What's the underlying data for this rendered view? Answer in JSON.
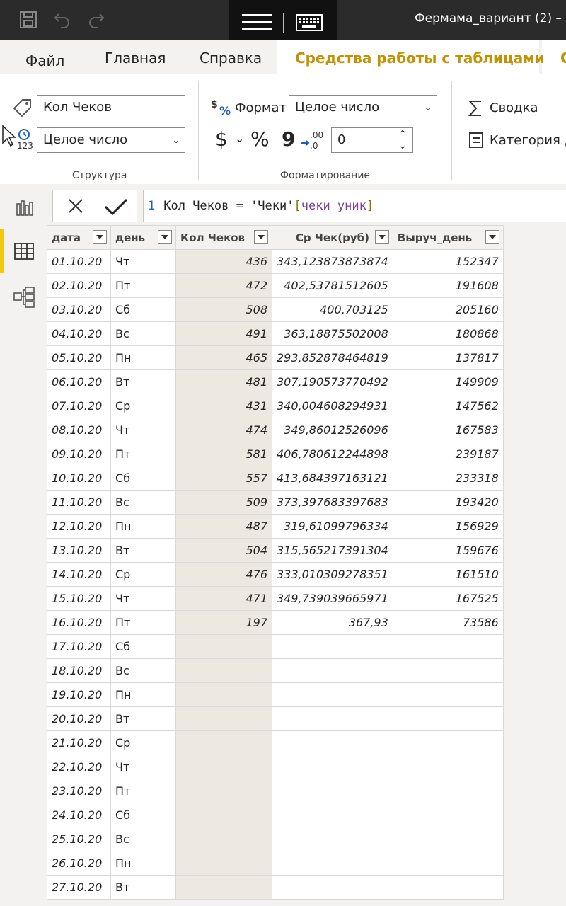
{
  "window": {
    "title": "Фермама_вариант (2) –"
  },
  "menu": {
    "file": "Файл",
    "home": "Главная",
    "help": "Справка",
    "table_tools": "Средства работы с таблицами",
    "next_tab": "С"
  },
  "ribbon": {
    "structure": {
      "name_value": "Кол Чеков",
      "data_type_value": "Целое число",
      "label": "Структура"
    },
    "formatting": {
      "format_label": "Формат",
      "format_value": "Целое число",
      "currency_symbol": "$",
      "percent_symbol": "%",
      "comma_symbol": "9",
      "decimals_value": "0",
      "label": "Форматирование"
    },
    "properties": {
      "summary_label": "Сводка",
      "category_label": "Категория да"
    }
  },
  "formula_bar": {
    "line_number": "1",
    "text_plain": "Кол Чеков = 'Чеки'",
    "text_column": "чеки уник",
    "open_bracket": "[",
    "close_bracket": "]"
  },
  "table": {
    "columns": [
      "дата",
      "день",
      "Кол Чеков",
      "Ср Чек(руб)",
      "Выруч_день"
    ],
    "selected_column": "Кол Чеков",
    "rows": [
      [
        "01.10.20",
        "Чт",
        "436",
        "343,123873873874",
        "152347"
      ],
      [
        "02.10.20",
        "Пт",
        "472",
        "402,53781512605",
        "191608"
      ],
      [
        "03.10.20",
        "Сб",
        "508",
        "400,703125",
        "205160"
      ],
      [
        "04.10.20",
        "Вс",
        "491",
        "363,18875502008",
        "180868"
      ],
      [
        "05.10.20",
        "Пн",
        "465",
        "293,852878464819",
        "137817"
      ],
      [
        "06.10.20",
        "Вт",
        "481",
        "307,190573770492",
        "149909"
      ],
      [
        "07.10.20",
        "Ср",
        "431",
        "340,004608294931",
        "147562"
      ],
      [
        "08.10.20",
        "Чт",
        "474",
        "349,86012526096",
        "167583"
      ],
      [
        "09.10.20",
        "Пт",
        "581",
        "406,780612244898",
        "239187"
      ],
      [
        "10.10.20",
        "Сб",
        "557",
        "413,684397163121",
        "233318"
      ],
      [
        "11.10.20",
        "Вс",
        "509",
        "373,397683397683",
        "193420"
      ],
      [
        "12.10.20",
        "Пн",
        "487",
        "319,61099796334",
        "156929"
      ],
      [
        "13.10.20",
        "Вт",
        "504",
        "315,565217391304",
        "159676"
      ],
      [
        "14.10.20",
        "Ср",
        "476",
        "333,010309278351",
        "161510"
      ],
      [
        "15.10.20",
        "Чт",
        "471",
        "349,739039665971",
        "167525"
      ],
      [
        "16.10.20",
        "Пт",
        "197",
        "367,93",
        "73586"
      ],
      [
        "17.10.20",
        "Сб",
        "",
        "",
        ""
      ],
      [
        "18.10.20",
        "Вс",
        "",
        "",
        ""
      ],
      [
        "19.10.20",
        "Пн",
        "",
        "",
        ""
      ],
      [
        "20.10.20",
        "Вт",
        "",
        "",
        ""
      ],
      [
        "21.10.20",
        "Ср",
        "",
        "",
        ""
      ],
      [
        "22.10.20",
        "Чт",
        "",
        "",
        ""
      ],
      [
        "23.10.20",
        "Пт",
        "",
        "",
        ""
      ],
      [
        "24.10.20",
        "Сб",
        "",
        "",
        ""
      ],
      [
        "25.10.20",
        "Вс",
        "",
        "",
        ""
      ],
      [
        "26.10.20",
        "Пн",
        "",
        "",
        ""
      ],
      [
        "27.10.20",
        "Вт",
        "",
        "",
        ""
      ]
    ]
  },
  "colors": {
    "accent": "#f2c811",
    "tools_tab_text": "#c49100",
    "titlebar": "#2b2b2b"
  },
  "icons": [
    "save-icon",
    "undo-icon",
    "redo-icon",
    "hamburger-icon",
    "keyboard-icon",
    "tag-icon",
    "data-type-icon",
    "format-icon",
    "sum-icon",
    "category-icon",
    "report-view-icon",
    "data-view-icon",
    "model-view-icon",
    "cancel-icon",
    "commit-icon",
    "filter-icon"
  ]
}
